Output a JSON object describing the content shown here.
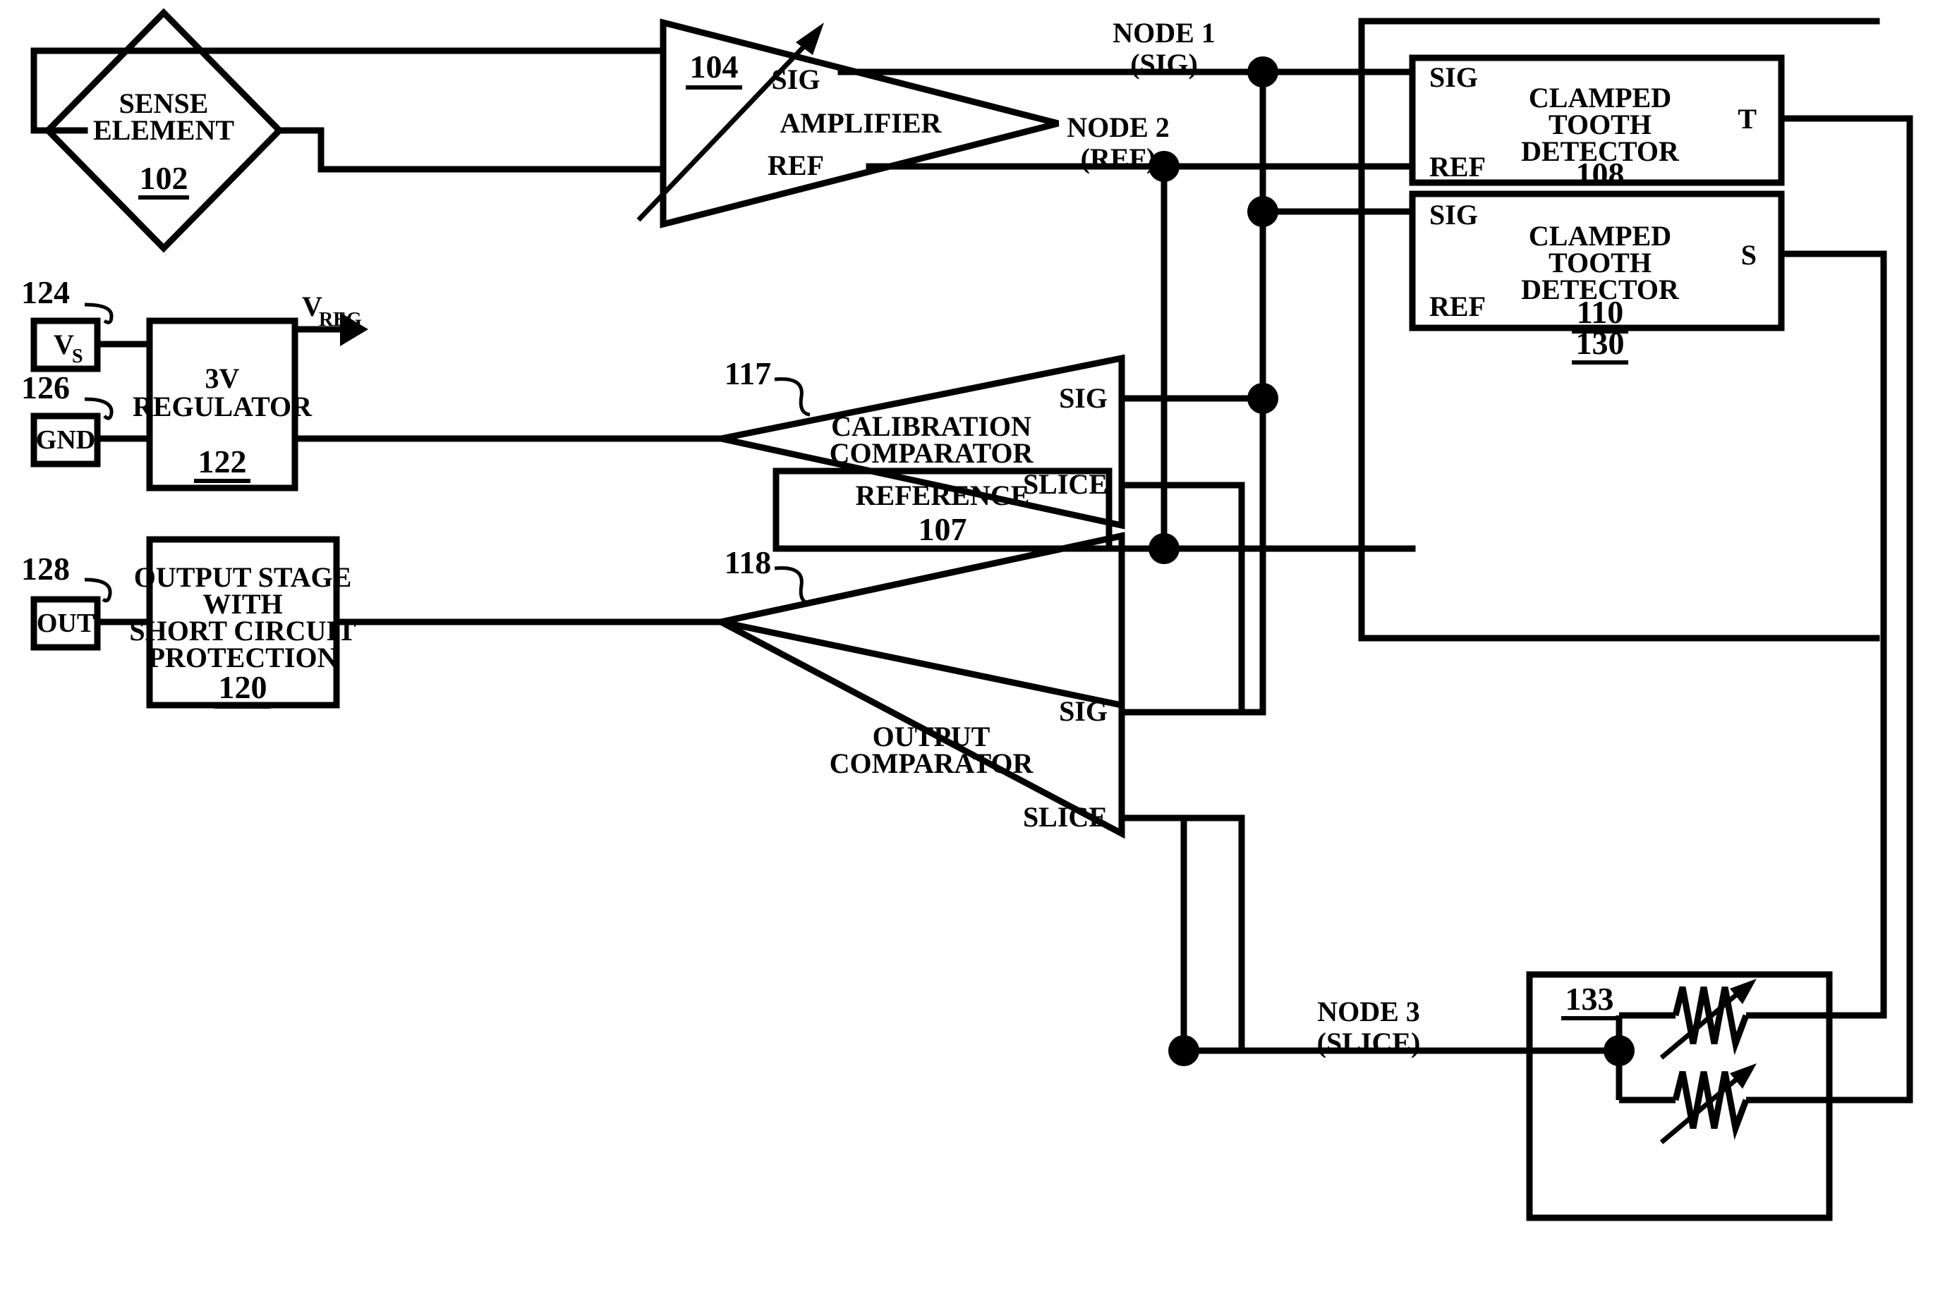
{
  "diagram": {
    "type": "patent-block-diagram",
    "title": "Magnetic sense element signal processing block diagram",
    "background_color": "#ffffff",
    "line_color": "#000000"
  },
  "blocks": {
    "sense_element": {
      "label_line1": "SENSE",
      "label_line2": "ELEMENT",
      "ref": "102",
      "shape": "diamond"
    },
    "amplifier": {
      "label": "AMPLIFIER",
      "ref": "104",
      "shape": "triangle-right",
      "port_sig": "SIG",
      "port_ref": "REF",
      "has_gain_arrow": true
    },
    "detector_tooth_t": {
      "label_line1": "CLAMPED",
      "label_line2": "TOOTH",
      "label_line3": "DETECTOR",
      "ref": "108",
      "port_sig": "SIG",
      "port_ref": "REF",
      "port_out": "T"
    },
    "detector_tooth_s": {
      "label_line1": "CLAMPED",
      "label_line2": "TOOTH",
      "label_line3": "DETECTOR",
      "ref": "110",
      "port_sig": "SIG",
      "port_ref": "REF",
      "port_out": "S"
    },
    "detector_group": {
      "ref": "130"
    },
    "reference": {
      "label": "REFERENCE",
      "ref": "107"
    },
    "regulator": {
      "label_line1": "3V",
      "label_line2": "REGULATOR",
      "ref": "122"
    },
    "output_stage": {
      "label_line1": "OUTPUT STAGE",
      "label_line2": "WITH",
      "label_line3": "SHORT CIRCUIT",
      "label_line4": "PROTECTION",
      "ref": "120"
    },
    "calibration_comparator": {
      "label_line1": "CALIBRATION",
      "label_line2": "COMPARATOR",
      "ref": "117",
      "port_sig": "SIG",
      "port_slice": "SLICE"
    },
    "output_comparator": {
      "label_line1": "OUTPUT",
      "label_line2": "COMPARATOR",
      "ref": "118",
      "port_sig": "SIG",
      "port_slice": "SLICE"
    },
    "resistor_network": {
      "ref": "133",
      "element_count": 2,
      "element_type": "variable-resistor"
    }
  },
  "pins": {
    "vs": {
      "label": "VS",
      "label_main": "V",
      "label_sub": "S",
      "ref": "124"
    },
    "gnd": {
      "label": "GND",
      "ref": "126"
    },
    "out": {
      "label": "OUT",
      "ref": "128"
    }
  },
  "signals": {
    "vreg": {
      "label_main": "V",
      "label_sub": "REG"
    },
    "node1": {
      "line1": "NODE 1",
      "line2": "(SIG)"
    },
    "node2": {
      "line1": "NODE 2",
      "line2": "(REF)"
    },
    "node3": {
      "line1": "NODE 3",
      "line2": "(SLICE)"
    }
  }
}
